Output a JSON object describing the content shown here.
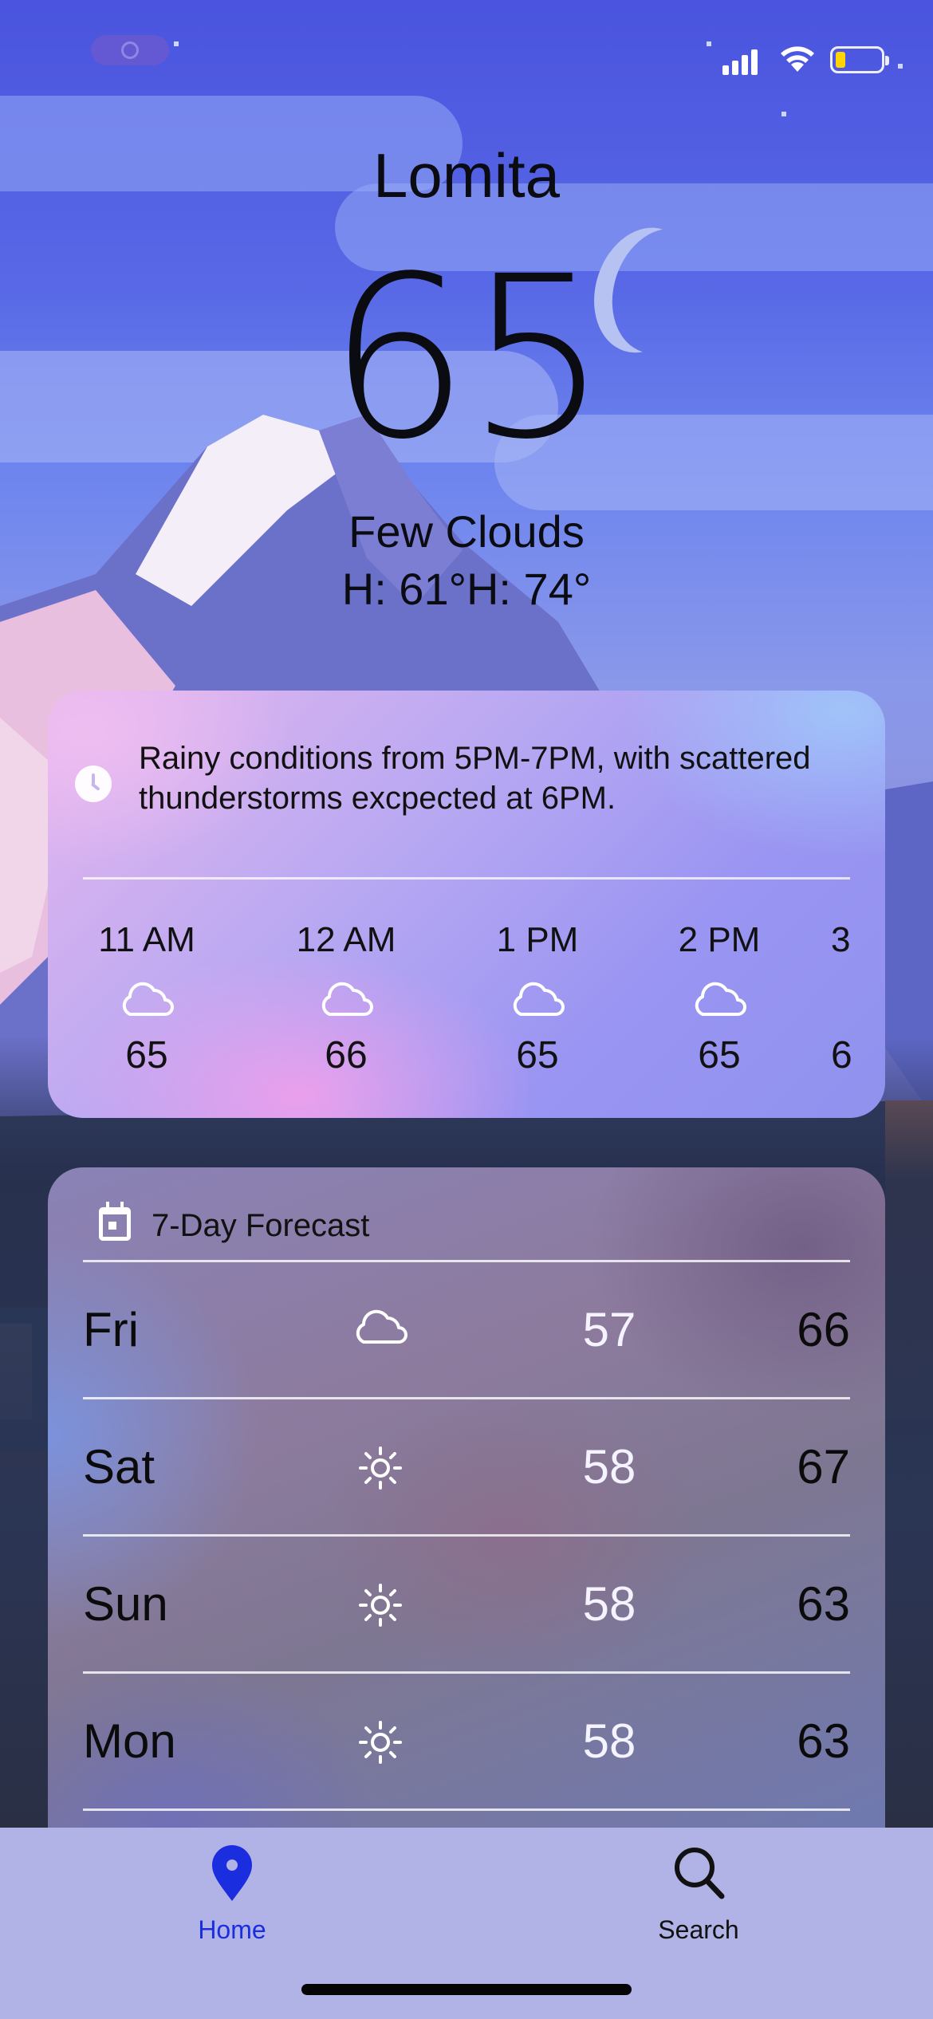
{
  "status_bar": {
    "icons": [
      "screen-recording-icon",
      "cellular-signal-icon",
      "wifi-icon",
      "battery-icon"
    ],
    "battery_level": 0.2,
    "battery_color": "#ffd400"
  },
  "location": {
    "city": "Lomita",
    "temperature": "65",
    "condition": "Few Clouds",
    "high_low": "H: 61°H: 74°"
  },
  "hourly": {
    "alert_icon": "clock-icon",
    "alert_text": "Rainy conditions from 5PM-7PM, with scattered thunderstorms excpected at 6PM.",
    "hours": [
      {
        "time": "11 AM",
        "icon": "cloud-icon",
        "temp": "65"
      },
      {
        "time": "12 AM",
        "icon": "cloud-icon",
        "temp": "66"
      },
      {
        "time": "1 PM",
        "icon": "cloud-icon",
        "temp": "65"
      },
      {
        "time": "2 PM",
        "icon": "cloud-icon",
        "temp": "65"
      },
      {
        "time": "3",
        "icon": "cloud-icon",
        "temp": "6"
      }
    ]
  },
  "forecast": {
    "icon": "calendar-icon",
    "title": "7-Day Forecast",
    "days": [
      {
        "day": "Fri",
        "icon": "cloud-icon",
        "low": "57",
        "high": "66"
      },
      {
        "day": "Sat",
        "icon": "sun-icon",
        "low": "58",
        "high": "67"
      },
      {
        "day": "Sun",
        "icon": "sun-icon",
        "low": "58",
        "high": "63"
      },
      {
        "day": "Mon",
        "icon": "sun-icon",
        "low": "58",
        "high": "63"
      }
    ]
  },
  "tab_bar": {
    "home_label": "Home",
    "search_label": "Search",
    "active_tab": "Home",
    "active_color": "#1a2ee0"
  }
}
